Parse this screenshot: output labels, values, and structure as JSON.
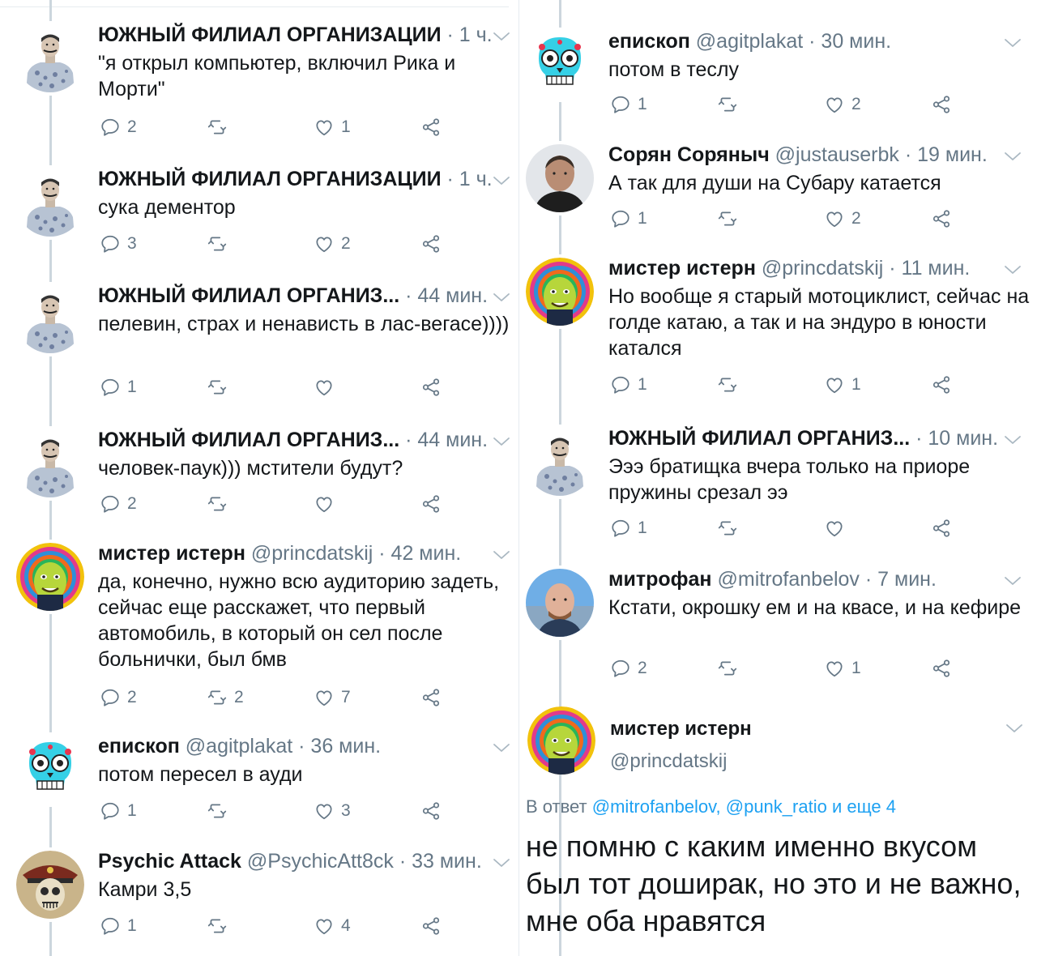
{
  "colors": {
    "text": "#14171a",
    "secondary": "#657786",
    "link": "#1da1f2",
    "thread_line": "#ccd6dd",
    "divider": "#e6ecf0"
  },
  "left_column": [
    {
      "name": "ЮЖНЫЙ ФИЛИАЛ ОРГАНИЗАЦИИ",
      "handle": "",
      "time": "· 1 ч.",
      "text": "\"я открыл компьютер, включил Рика и Морти\"",
      "replies": "2",
      "retweets": "",
      "likes": "1",
      "avatar": "tattoo-man-avatar"
    },
    {
      "name": "ЮЖНЫЙ ФИЛИАЛ ОРГАНИЗАЦИИ",
      "handle": "",
      "time": "· 1 ч.",
      "text": "сука дементор",
      "replies": "3",
      "retweets": "",
      "likes": "2",
      "avatar": "tattoo-man-avatar"
    },
    {
      "name": "ЮЖНЫЙ ФИЛИАЛ ОРГАНИЗ...",
      "handle": "",
      "time": "· 44 мин.",
      "text": "пелевин, страх и ненависть в лас-вегасе))))",
      "replies": "1",
      "retweets": "",
      "likes": "",
      "avatar": "tattoo-man-avatar"
    },
    {
      "name": "ЮЖНЫЙ ФИЛИАЛ ОРГАНИЗ...",
      "handle": "",
      "time": "· 44 мин.",
      "text": "человек-паук))) мстители будут?",
      "replies": "2",
      "retweets": "",
      "likes": "",
      "avatar": "tattoo-man-avatar"
    },
    {
      "name": "мистер истерн",
      "handle": "@princdatskij",
      "time": "· 42 мин.",
      "text": "да, конечно, нужно всю аудиторию задеть, сейчас еще расскажет, что первый автомобиль, в который он сел после больнички, был бмв",
      "replies": "2",
      "retweets": "2",
      "likes": "7",
      "avatar": "psychedelic-face-avatar"
    },
    {
      "name": "епископ",
      "handle": "@agitplakat",
      "time": "· 36 мин.",
      "text": "потом пересел в ауди",
      "replies": "1",
      "retweets": "",
      "likes": "3",
      "avatar": "sugar-skull-avatar"
    },
    {
      "name": "Psychic Attack",
      "handle": "@PsychicAtt8ck",
      "time": "· 33 мин.",
      "text": "Камри 3,5",
      "replies": "1",
      "retweets": "",
      "likes": "4",
      "avatar": "skull-officer-avatar"
    }
  ],
  "right_column": [
    {
      "name": "епископ",
      "handle": "@agitplakat",
      "time": "· 30 мин.",
      "text": "потом в теслу",
      "replies": "1",
      "retweets": "",
      "likes": "2",
      "avatar": "sugar-skull-avatar"
    },
    {
      "name": "Сорян Соряныч",
      "handle": "@justauserbk",
      "time": "· 19 мин.",
      "text": "А так для души на Субару катается",
      "replies": "1",
      "retweets": "",
      "likes": "2",
      "avatar": "man-photo-avatar"
    },
    {
      "name": "мистер истерн",
      "handle": "@princdatskij",
      "time": "· 11 мин.",
      "text": "Но вообще я старый мотоциклист, сейчас на голде катаю, а так и на эндуро в юности катался",
      "replies": "1",
      "retweets": "",
      "likes": "1",
      "avatar": "psychedelic-face-avatar"
    },
    {
      "name": "ЮЖНЫЙ ФИЛИАЛ ОРГАНИЗ...",
      "handle": "",
      "time": "· 10 мин.",
      "text": "Эээ братищка вчера только на приоре пружины срезал ээ",
      "replies": "1",
      "retweets": "",
      "likes": "",
      "avatar": "tattoo-man-avatar"
    },
    {
      "name": "митрофан",
      "handle": "@mitrofanbelov",
      "time": "· 7 мин.",
      "text": "Кстати, окрошку ем и на квасе, и на кефире",
      "replies": "2",
      "retweets": "",
      "likes": "1",
      "avatar": "bald-man-photo-avatar"
    }
  ],
  "focused": {
    "name": "мистер истерн",
    "handle": "@princdatskij",
    "reply_prefix": "В ответ",
    "reply_mentions": "@mitrofanbelov, @punk_ratio и еще 4",
    "text": "не помню с каким именно вкусом был тот доширак, но это и не важно, мне оба нравятся"
  }
}
